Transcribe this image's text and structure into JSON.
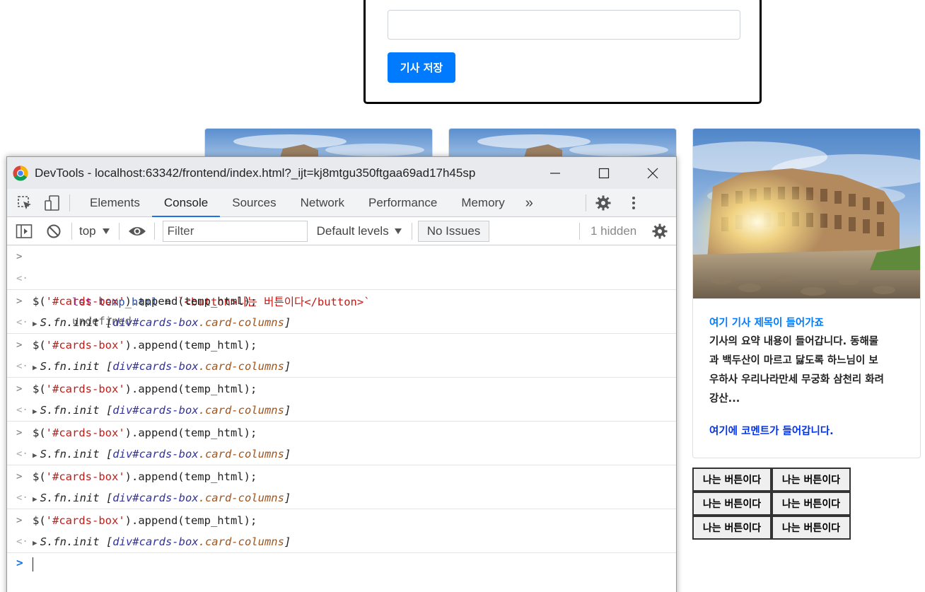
{
  "page": {
    "save_button": "기사 저장",
    "card": {
      "title": "여기 기사 제목이 들어가죠",
      "text_lines": [
        "기사의 요약 내용이 들어갑니다. 동해물",
        "과 백두산이 마르고 닳도록 하느님이 보",
        "우하사 우리나라만세 무궁화 삼천리 화려",
        "강산..."
      ],
      "comment": "여기에 코멘트가 들어갑니다."
    },
    "appended_buttons": [
      "나는 버튼이다",
      "나는 버튼이다",
      "나는 버튼이다",
      "나는 버튼이다",
      "나는 버튼이다",
      "나는 버튼이다"
    ]
  },
  "devtools": {
    "window_title": "DevTools - localhost:63342/frontend/index.html?_ijt=kj8mtgu350ftgaa69ad17h45sp",
    "tabs": [
      "Elements",
      "Console",
      "Sources",
      "Network",
      "Performance",
      "Memory"
    ],
    "active_tab": "Console",
    "overflow": "»",
    "context": "top",
    "filter_placeholder": "Filter",
    "levels": "Default levels",
    "issues": "No Issues",
    "hidden": "1 hidden",
    "console": {
      "first_input": {
        "kw": "let",
        "var": "temp_html",
        "op": " = ",
        "str": "`<button>나는 버튼이다</button>`"
      },
      "first_result": "undefined",
      "entries": [
        {
          "input_prefix": "$(",
          "input_str": "'#cards-box'",
          "input_suffix": ").append(temp_html);",
          "out_obj": "S.fn.init",
          "out_open": " [",
          "out_el": "div#cards-box",
          "out_cls": ".card-columns",
          "out_close": "]"
        },
        {
          "input_prefix": "$(",
          "input_str": "'#cards-box'",
          "input_suffix": ").append(temp_html);",
          "out_obj": "S.fn.init",
          "out_open": " [",
          "out_el": "div#cards-box",
          "out_cls": ".card-columns",
          "out_close": "]"
        },
        {
          "input_prefix": "$(",
          "input_str": "'#cards-box'",
          "input_suffix": ").append(temp_html);",
          "out_obj": "S.fn.init",
          "out_open": " [",
          "out_el": "div#cards-box",
          "out_cls": ".card-columns",
          "out_close": "]"
        },
        {
          "input_prefix": "$(",
          "input_str": "'#cards-box'",
          "input_suffix": ").append(temp_html);",
          "out_obj": "S.fn.init",
          "out_open": " [",
          "out_el": "div#cards-box",
          "out_cls": ".card-columns",
          "out_close": "]"
        },
        {
          "input_prefix": "$(",
          "input_str": "'#cards-box'",
          "input_suffix": ").append(temp_html);",
          "out_obj": "S.fn.init",
          "out_open": " [",
          "out_el": "div#cards-box",
          "out_cls": ".card-columns",
          "out_close": "]"
        },
        {
          "input_prefix": "$(",
          "input_str": "'#cards-box'",
          "input_suffix": ").append(temp_html);",
          "out_obj": "S.fn.init",
          "out_open": " [",
          "out_el": "div#cards-box",
          "out_cls": ".card-columns",
          "out_close": "]"
        }
      ]
    }
  },
  "colors": {
    "primary": "#007bff",
    "active_tab": "#1a73e8",
    "comment": "#0033ee"
  },
  "icons": [
    "chrome-icon",
    "inspect-icon",
    "device-toolbar-icon",
    "more-tabs-icon",
    "settings-gear-icon",
    "kebab-menu-icon",
    "sidebar-toggle-icon",
    "clear-console-icon",
    "eye-icon",
    "dropdown-arrow-icon",
    "settings-gear-icon"
  ]
}
